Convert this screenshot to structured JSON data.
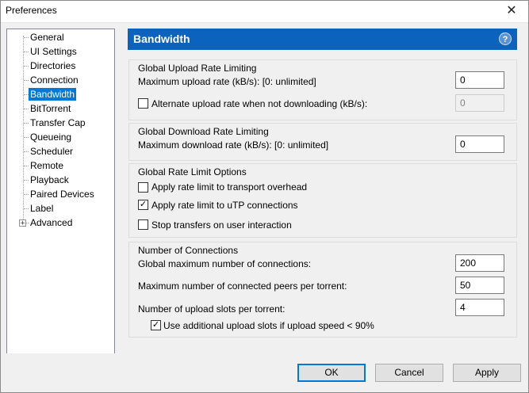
{
  "window": {
    "title": "Preferences",
    "close_glyph": "✕"
  },
  "tree": {
    "items": [
      {
        "label": "General"
      },
      {
        "label": "UI Settings"
      },
      {
        "label": "Directories"
      },
      {
        "label": "Connection"
      },
      {
        "label": "Bandwidth",
        "selected": true
      },
      {
        "label": "BitTorrent"
      },
      {
        "label": "Transfer Cap"
      },
      {
        "label": "Queueing"
      },
      {
        "label": "Scheduler"
      },
      {
        "label": "Remote"
      },
      {
        "label": "Playback"
      },
      {
        "label": "Paired Devices"
      },
      {
        "label": "Label"
      },
      {
        "label": "Advanced",
        "expandable": true
      }
    ],
    "expander_glyph": "+"
  },
  "header": {
    "title": "Bandwidth",
    "help_glyph": "?",
    "color": "#0c63bd"
  },
  "upload": {
    "title": "Global Upload Rate Limiting",
    "max_label": "Maximum upload rate (kB/s): [0: unlimited]",
    "max_value": "0",
    "alt_label": "Alternate upload rate when not downloading (kB/s):",
    "alt_checked": false,
    "alt_value": "0"
  },
  "download": {
    "title": "Global Download Rate Limiting",
    "max_label": "Maximum download rate (kB/s): [0: unlimited]",
    "max_value": "0"
  },
  "options": {
    "title": "Global Rate Limit Options",
    "overhead_label": "Apply rate limit to transport overhead",
    "overhead_checked": false,
    "utp_label": "Apply rate limit to uTP connections",
    "utp_checked": true,
    "stop_label": "Stop transfers on user interaction",
    "stop_checked": false
  },
  "connections": {
    "title": "Number of Connections",
    "global_label": "Global maximum number of connections:",
    "global_value": "200",
    "peers_label": "Maximum number of connected peers per torrent:",
    "peers_value": "50",
    "slots_label": "Number of upload slots per torrent:",
    "slots_value": "4",
    "additional_label": "Use additional upload slots if upload speed < 90%",
    "additional_checked": true
  },
  "buttons": {
    "ok": "OK",
    "cancel": "Cancel",
    "apply": "Apply"
  },
  "check_glyph": "✓",
  "accent": "#0078d7"
}
